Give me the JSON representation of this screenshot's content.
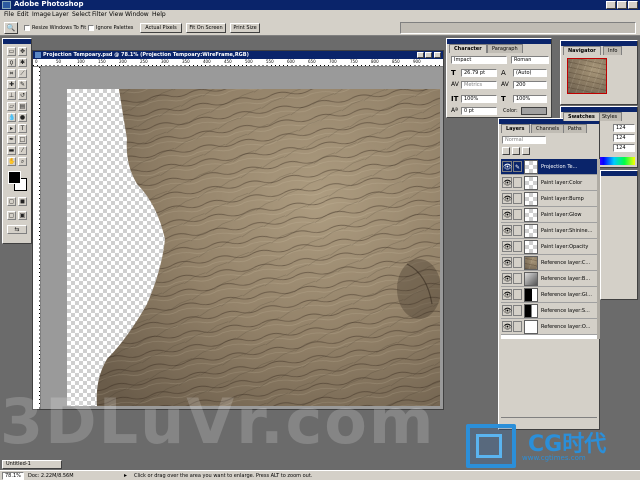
{
  "app": {
    "title": "Adobe Photoshop"
  },
  "menu": [
    "File",
    "Edit",
    "Image",
    "Layer",
    "Select",
    "Filter",
    "View",
    "Window",
    "Help"
  ],
  "options_bar": {
    "resize_label": "Resize Windows To Fit",
    "ignore_label": "Ignore Palettes",
    "actual_pixels": "Actual Pixels",
    "fit_on_screen": "Fit On Screen",
    "print_size": "Print Size"
  },
  "document": {
    "title": "Projection Tempoary.psd @ 78.1% (Projection Tempoary:WireFrame,RGB)",
    "ruler_ticks": [
      "0",
      "50",
      "100",
      "150",
      "200",
      "250",
      "300",
      "350",
      "400",
      "450",
      "500",
      "550",
      "600",
      "650",
      "700",
      "750",
      "800",
      "850",
      "900"
    ]
  },
  "character_panel": {
    "tabs": [
      "Character",
      "Paragraph"
    ],
    "font": "Impact",
    "style": "Roman",
    "size": "26.79 pt",
    "leading": "(Auto)",
    "kerning": "Metrics",
    "tracking": "200",
    "vscale": "100%",
    "hscale": "100%",
    "baseline": "0 pt",
    "color_label": "Color:"
  },
  "navigator_panel": {
    "tabs": [
      "Navigator",
      "Info"
    ]
  },
  "swatches_panel": {
    "tabs": [
      "Swatches",
      "Styles"
    ],
    "values": [
      "124",
      "124",
      "124"
    ]
  },
  "layers_panel": {
    "tabs": [
      "Layers",
      "Channels",
      "Paths"
    ],
    "blend_mode": "Normal",
    "layers": [
      {
        "name": "Projection Te...",
        "selected": true
      },
      {
        "name": "Paint layer:Color",
        "selected": false
      },
      {
        "name": "Paint layer:Bump",
        "selected": false
      },
      {
        "name": "Paint layer:Glow",
        "selected": false
      },
      {
        "name": "Paint layer:Shinine...",
        "selected": false
      },
      {
        "name": "Paint layer:Opacity",
        "selected": false
      },
      {
        "name": "Reference layer:C...",
        "selected": false
      },
      {
        "name": "Reference layer:B...",
        "selected": false
      },
      {
        "name": "Reference layer:Gl...",
        "selected": false
      },
      {
        "name": "Reference layer:S...",
        "selected": false
      },
      {
        "name": "Reference layer:O...",
        "selected": false
      }
    ]
  },
  "status_bar": {
    "zoom": "78.1%",
    "doc": "Doc: 2.22M/8.56M",
    "hint": "Click or drag over the area you want to enlarge. Press ALT to zoom out."
  },
  "watermarks": {
    "left": "3DLuVr.com",
    "brand": "CG时代",
    "url": "www.cgtimes.com"
  },
  "taskbar": {
    "item": "Untitled-1"
  }
}
